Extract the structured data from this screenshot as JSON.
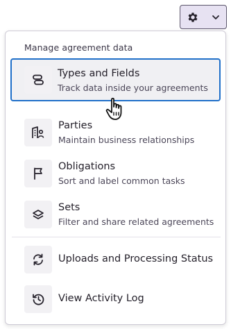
{
  "settings_button": {
    "icon": "gear-icon",
    "caret": "chevron-down-icon"
  },
  "menu": {
    "section_label": "Manage agreement data",
    "items": [
      {
        "title": "Types and Fields",
        "subtitle": "Track data inside your agreements",
        "icon": "types-fields-icon",
        "highlighted": true
      },
      {
        "title": "Parties",
        "subtitle": "Maintain business relationships",
        "icon": "parties-icon"
      },
      {
        "title": "Obligations",
        "subtitle": "Sort and label common tasks",
        "icon": "flag-icon"
      },
      {
        "title": "Sets",
        "subtitle": "Filter and share related agreements",
        "icon": "layers-icon"
      }
    ],
    "actions": [
      {
        "title": "Uploads and Processing Status",
        "icon": "sync-icon"
      },
      {
        "title": "View Activity Log",
        "icon": "history-icon"
      }
    ]
  },
  "colors": {
    "highlight_border": "#1f6fc9",
    "button_bg": "#e7e2f2",
    "tile_bg": "#f2f1f4",
    "text": "#25212b"
  }
}
